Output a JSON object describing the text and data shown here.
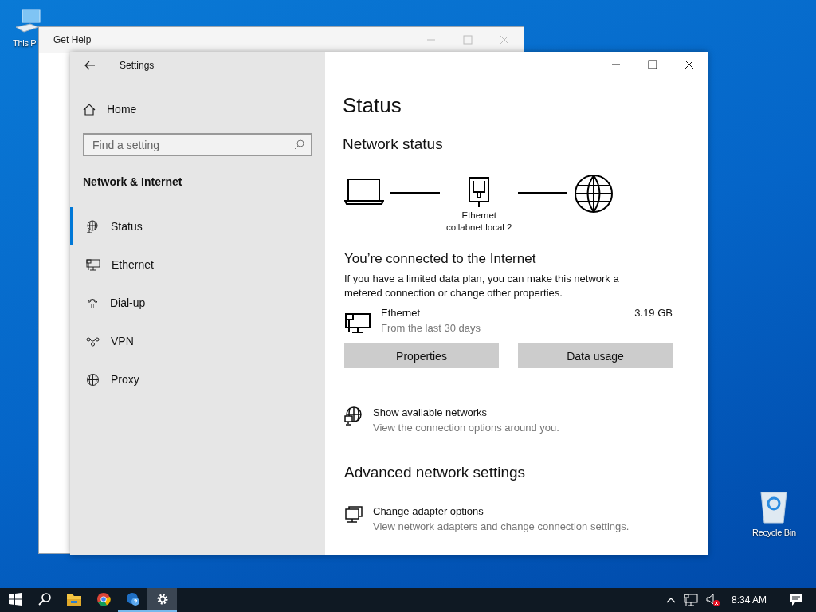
{
  "desktop_icons": [
    {
      "kind": "computer",
      "label": "This P"
    },
    {
      "kind": "recycle",
      "label": "Recycle Bin"
    }
  ],
  "background_window": {
    "title": "Get Help"
  },
  "settings": {
    "title": "Settings",
    "home": "Home",
    "search": {
      "placeholder": "Find a setting"
    },
    "section": "Network & Internet",
    "nav": [
      {
        "kind": "status",
        "label": "Status",
        "selected": true
      },
      {
        "kind": "ethernet",
        "label": "Ethernet",
        "selected": false
      },
      {
        "kind": "dialup",
        "label": "Dial-up",
        "selected": false
      },
      {
        "kind": "vpn",
        "label": "VPN",
        "selected": false
      },
      {
        "kind": "proxy",
        "label": "Proxy",
        "selected": false
      }
    ],
    "page_title": "Status",
    "network_status": {
      "heading": "Network status",
      "adapter": "Ethernet",
      "network": "collabnet.local 2"
    },
    "connected_heading": "You’re connected to the Internet",
    "connected_text": "If you have a limited data plan, you can make this network a metered connection or change other properties.",
    "usage": {
      "name": "Ethernet",
      "period": "From the last 30 days",
      "amount": "3.19 GB"
    },
    "buttons": [
      "Properties",
      "Data usage"
    ],
    "links": [
      {
        "kind": "globe",
        "title": "Show available networks",
        "description": "View the connection options around you."
      }
    ],
    "advanced_heading": "Advanced network settings",
    "advanced": [
      {
        "kind": "adapter",
        "title": "Change adapter options",
        "description": "View network adapters and change connection settings."
      }
    ]
  },
  "taskbar": {
    "apps": [
      {
        "kind": "explorer",
        "running": false,
        "selected": false
      },
      {
        "kind": "browser",
        "running": false,
        "selected": false
      },
      {
        "kind": "help",
        "running": true,
        "selected": false
      },
      {
        "kind": "settings",
        "running": true,
        "selected": true
      }
    ],
    "clock": "8:34 AM"
  }
}
